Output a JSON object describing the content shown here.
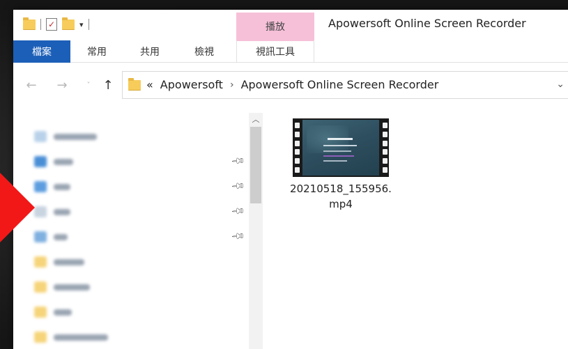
{
  "window": {
    "title": "Apowersoft Online Screen Recorder"
  },
  "quick_access_toolbar": {
    "icons": [
      "folder-icon",
      "properties-icon",
      "new-folder-icon",
      "customize-dropdown-icon"
    ]
  },
  "ribbon": {
    "context_tab_group": "播放",
    "tabs": [
      {
        "label": "檔案",
        "active": true
      },
      {
        "label": "常用"
      },
      {
        "label": "共用"
      },
      {
        "label": "檢視"
      },
      {
        "label": "視訊工具"
      }
    ],
    "accent_color": "#1c5fb8",
    "context_color": "#f6c0d8"
  },
  "navigation": {
    "back_icon": "arrow-left-icon",
    "forward_icon": "arrow-right-icon",
    "up_icon": "arrow-up-icon"
  },
  "address_bar": {
    "overflow": "«",
    "breadcrumb": [
      "Apowersoft",
      "Apowersoft Online Screen Recorder"
    ],
    "separator": "›"
  },
  "nav_pane": {
    "items_blurred": true,
    "pinned_count": 4
  },
  "files": [
    {
      "name": "20210518_155956.mp4",
      "type": "video"
    }
  ],
  "overlay": {
    "arrow_color": "#f21818"
  }
}
